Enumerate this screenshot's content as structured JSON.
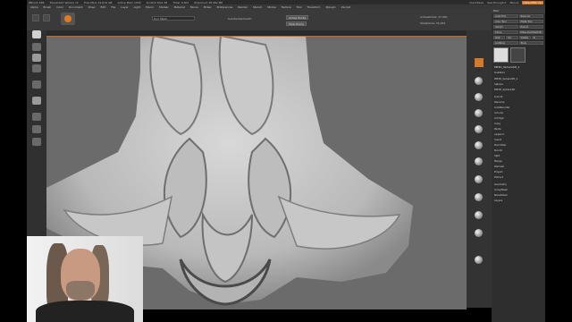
{
  "titlebar": {
    "app": "ZBrush 4R6",
    "doc": "Deviantart Sphere 1C",
    "mem": "Free Mem 19.619 GB",
    "active": "Active Mem 1050",
    "scratch": "Scratch Disk 48",
    "timer": "Timer 0.001",
    "points": "PolyCount 38.462 MP",
    "quicksave": "QuickSave",
    "seethrough": "See-through 0",
    "menus": "Menus",
    "script": "DefaultZScript"
  },
  "menubar": {
    "items": [
      "Alpha",
      "Brush",
      "Color",
      "Document",
      "Draw",
      "Edit",
      "File",
      "Layer",
      "Light",
      "Macro",
      "Marker",
      "Material",
      "Movie",
      "Picker",
      "Preferences",
      "Render",
      "Stencil",
      "Stroke",
      "Texture",
      "Tool",
      "Transform",
      "Zplugin",
      "Zscript"
    ]
  },
  "shelf": {
    "hd_label": "Dyn Mesh",
    "subtool": "SubdivideSmooth",
    "poly": "Active Points",
    "total": "Total Points",
    "active_pts": "ActivePoints: 27,991",
    "total_pts": "TotalPoints: 55,951"
  },
  "rpanel": {
    "header": "Tool",
    "rows": [
      [
        "Load Tool",
        "Save As"
      ],
      [
        "Copy Tool",
        "Paste Tool"
      ],
      [
        "Import",
        "Export"
      ],
      [
        "Clone",
        "Make PolyMesh3D"
      ],
      [
        "GoZ",
        "All",
        "Visible",
        "R"
      ],
      [
        "Lightbox",
        "Tools"
      ]
    ],
    "tool_name": "PM3D_Sphere3D_1",
    "subtool_header": "SubTool",
    "subtools": [
      "PM3D_Sphere3D_1",
      "Sphere",
      "PM3D_Sphere3D"
    ],
    "lower": [
      "List All",
      "Rename",
      "AutoReorder",
      "All Low",
      "All High",
      "Copy",
      "Paste",
      "Append",
      "Insert",
      "Del Other",
      "Del All",
      "Split",
      "Merge",
      "Remesh",
      "Project",
      "Extract"
    ],
    "menus": [
      "Geometry",
      "ArrayMesh",
      "NanoMesh",
      "Layers"
    ]
  }
}
